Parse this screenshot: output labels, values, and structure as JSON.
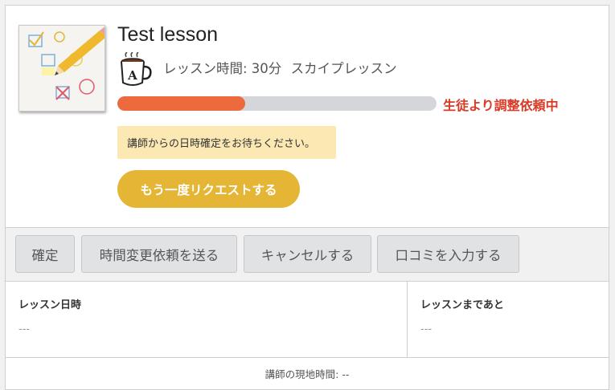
{
  "lesson": {
    "title": "Test lesson",
    "duration": "レッスン時間: 30分",
    "type": "スカイプレッスン",
    "thumbnail_icon": "checklist-pencil-icon",
    "type_icon": "coffee-mug-icon",
    "icon_letter": "A"
  },
  "status": {
    "progress": 0.4,
    "text": "生徒より調整依頼中",
    "fill_color": "#ed6a3c",
    "text_color": "#d93a25"
  },
  "notice": {
    "text": "講師からの日時確定をお待ちください。"
  },
  "request_button": {
    "label": "もう一度リクエストする",
    "color": "#e5b535"
  },
  "actions": {
    "buttons": [
      {
        "label": "確定"
      },
      {
        "label": "時間変更依頼を送る"
      },
      {
        "label": "キャンセルする"
      },
      {
        "label": "口コミを入力する"
      }
    ]
  },
  "info": {
    "lesson_datetime_label": "レッスン日時",
    "lesson_datetime_value": "---",
    "until_lesson_label": "レッスンまであと",
    "until_lesson_value": "---"
  },
  "footer": {
    "teacher_local_time": "講師の現地時間: --"
  }
}
